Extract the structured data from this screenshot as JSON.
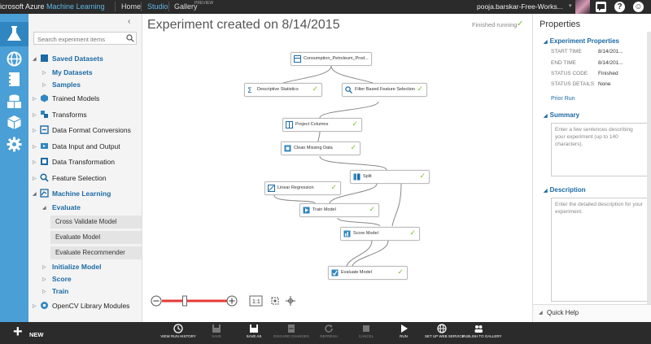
{
  "topbar": {
    "brand_prefix": "icrosoft Azure",
    "brand_product": "Machine Learning",
    "nav": [
      "Home",
      "Studio",
      "Gallery"
    ],
    "gallery_badge": "PREVIEW",
    "user": "pooja.barskar-Free-Works...",
    "help": "?",
    "smiley": "☺"
  },
  "palette": {
    "search_placeholder": "Search experiment items",
    "items": [
      {
        "label": "Saved Datasets",
        "style": "blue"
      },
      {
        "label": "My Datasets",
        "style": "blue"
      },
      {
        "label": "Samples",
        "style": "blue"
      },
      {
        "label": "Trained Models",
        "style": "normal"
      },
      {
        "label": "Transforms",
        "style": "normal"
      },
      {
        "label": "Data Format Conversions",
        "style": "normal"
      },
      {
        "label": "Data Input and Output",
        "style": "normal"
      },
      {
        "label": "Data Transformation",
        "style": "normal"
      },
      {
        "label": "Feature Selection",
        "style": "normal"
      },
      {
        "label": "Machine Learning",
        "style": "blue"
      },
      {
        "label": "Evaluate",
        "style": "blue"
      },
      {
        "label": "Initialize Model",
        "style": "blue"
      },
      {
        "label": "Score",
        "style": "blue"
      },
      {
        "label": "Train",
        "style": "blue"
      },
      {
        "label": "OpenCV Library Modules",
        "style": "normal"
      }
    ],
    "modules": [
      "Cross Validate Model",
      "Evaluate Model",
      "Evaluate Recommender"
    ]
  },
  "experiment": {
    "title": "Experiment created on 8/14/2015",
    "status": "Finished running",
    "nodes": [
      {
        "label": "Consumption_Petroleum_Prod...",
        "check": ""
      },
      {
        "label": "Descriptive Statistics",
        "check": "✓"
      },
      {
        "label": "Filter Based Feature Selection",
        "check": "✓"
      },
      {
        "label": "Project Columns",
        "check": "✓"
      },
      {
        "label": "Clean Missing Data",
        "check": "✓"
      },
      {
        "label": "Split",
        "check": "✓"
      },
      {
        "label": "Linear Regression",
        "check": "✓"
      },
      {
        "label": "Train Model",
        "check": "✓"
      },
      {
        "label": "Score Model",
        "check": "✓"
      },
      {
        "label": "Evaluate Model",
        "check": "✓"
      }
    ],
    "zoom": {
      "level": 0.35,
      "fit_label": "1:1"
    }
  },
  "properties": {
    "title": "Properties",
    "section_experiment": "Experiment Properties",
    "rows": [
      {
        "key": "START TIME",
        "value": "8/14/201..."
      },
      {
        "key": "END TIME",
        "value": "8/14/201..."
      },
      {
        "key": "STATUS CODE",
        "value": "Finished"
      },
      {
        "key": "STATUS DETAILS",
        "value": "None"
      }
    ],
    "prior_run": "Prior Run",
    "summary_title": "Summary",
    "summary_placeholder": "Enter a few sentences describing your experiment (up to 140 characters).",
    "description_title": "Description",
    "description_placeholder": "Enter the detailed description for your experiment.",
    "quick_help": "Quick Help"
  },
  "bottombar": {
    "new": "NEW",
    "buttons": [
      {
        "label": "VIEW RUN HISTORY",
        "icon": "clock-icon",
        "enabled": true
      },
      {
        "label": "SAVE",
        "icon": "save-icon",
        "enabled": false
      },
      {
        "label": "SAVE AS",
        "icon": "save-as-icon",
        "enabled": true
      },
      {
        "label": "DISCARD CHANGES",
        "icon": "discard-icon",
        "enabled": false
      },
      {
        "label": "REFRESH",
        "icon": "refresh-icon",
        "enabled": false
      },
      {
        "label": "CANCEL",
        "icon": "cancel-icon",
        "enabled": false
      },
      {
        "label": "RUN",
        "icon": "run-icon",
        "enabled": true
      },
      {
        "label": "SET UP WEB SERVICE",
        "icon": "web-service-icon",
        "enabled": true
      },
      {
        "label": "PUBLISH TO GALLERY",
        "icon": "publish-icon",
        "enabled": true
      }
    ]
  },
  "colors": {
    "accent": "#60b7e6",
    "rail": "#4a9fd6",
    "success": "#7cbf2a",
    "zoom_track": "#e53935"
  }
}
